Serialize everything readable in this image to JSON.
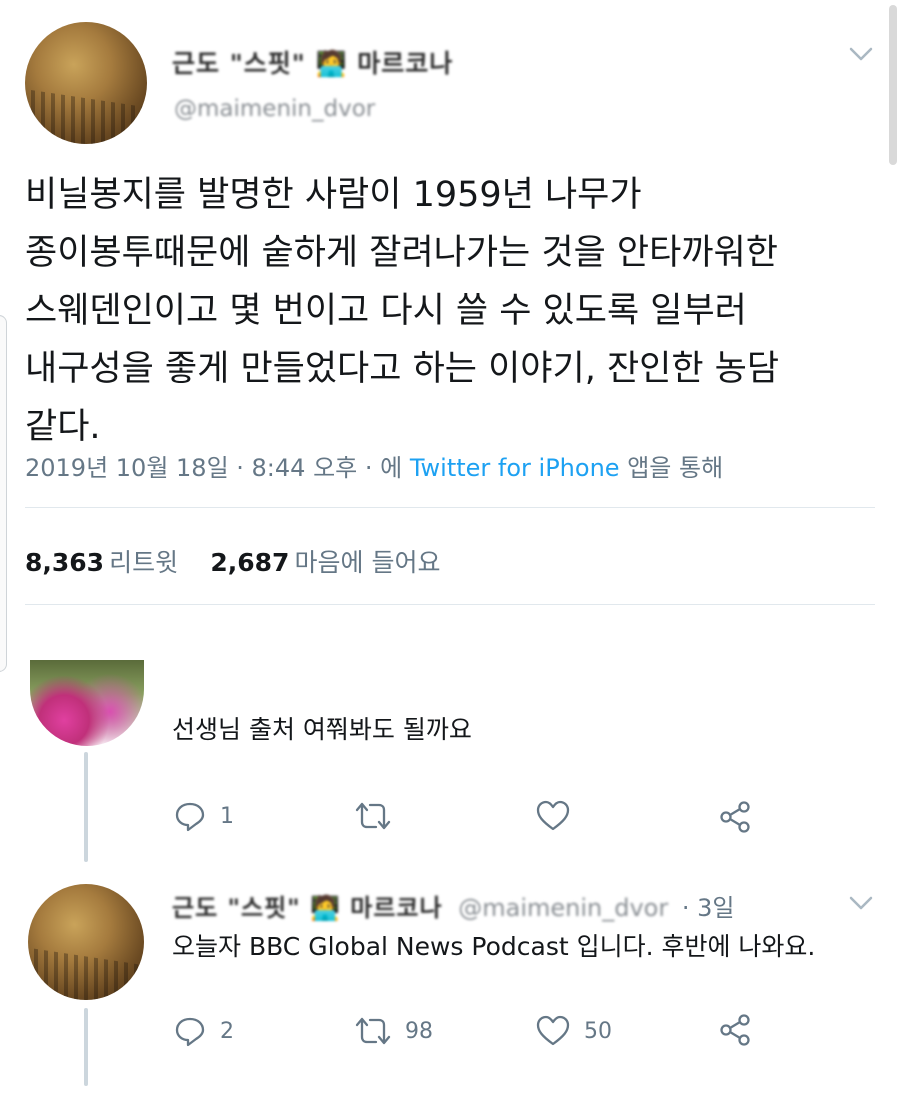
{
  "tweet": {
    "author_name": "근도 \"스핏\" 🧑‍💻 마르코나",
    "handle": "@maimenin_dvor",
    "text_lines": [
      "비닐봉지를 발명한 사람이 1959년 나무가",
      "종이봉투때문에 숱하게 잘려나가는 것을 안타까워한",
      "스웨덴인이고 몇 번이고 다시 쓸 수 있도록 일부러",
      "내구성을 좋게 만들었다고 하는 이야기, 잔인한 농담",
      "같다."
    ],
    "meta_prefix": "2019년 10월 18일 · 8:44 오후 · 에",
    "meta_source": "Twitter for iPhone",
    "meta_suffix": "앱을 통해",
    "retweets_count": "8,363",
    "retweets_label": "리트윗",
    "likes_count": "2,687",
    "likes_label": "마음에 들어요"
  },
  "replies": [
    {
      "text": "선생님 출처 여쭤봐도 될까요",
      "reply_count": "1",
      "retweet_count": "",
      "like_count": ""
    },
    {
      "author_name": "근도 \"스핏\" 🧑‍💻 마르코나",
      "handle": "@maimenin_dvor",
      "time": "· 3일",
      "text": "오늘자 BBC Global News Podcast 입니다. 후반에 나와요.",
      "reply_count": "2",
      "retweet_count": "98",
      "like_count": "50"
    }
  ],
  "icons": {
    "chevron": "chevron-down-icon",
    "reply": "reply-icon",
    "retweet": "retweet-icon",
    "like": "heart-icon",
    "share": "share-icon"
  },
  "colors": {
    "link": "#1da1f2",
    "secondary_text": "#657786",
    "divider": "#e1e8ed"
  }
}
